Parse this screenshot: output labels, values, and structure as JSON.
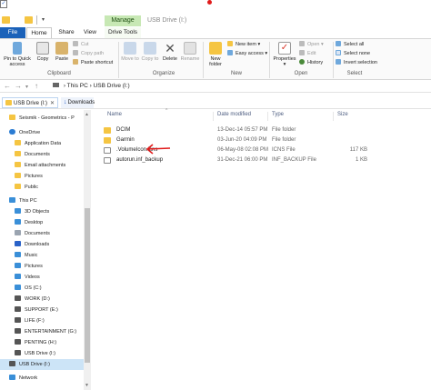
{
  "window": {
    "title": "USB Drive (I:)",
    "contextual_tab": "Manage"
  },
  "tabs": {
    "file": "File",
    "home": "Home",
    "share": "Share",
    "view": "View",
    "drive_tools": "Drive Tools"
  },
  "ribbon": {
    "clipboard": {
      "label": "Clipboard",
      "pin": "Pin to Quick access",
      "copy": "Copy",
      "paste": "Paste",
      "cut": "Cut",
      "copy_path": "Copy path",
      "paste_shortcut": "Paste shortcut"
    },
    "organize": {
      "label": "Organize",
      "move_to": "Move to",
      "copy_to": "Copy to",
      "delete": "Delete",
      "rename": "Rename"
    },
    "new": {
      "label": "New",
      "new_folder": "New folder",
      "new_item": "New item",
      "easy_access": "Easy access"
    },
    "open": {
      "label": "Open",
      "properties": "Properties",
      "open": "Open",
      "edit": "Edit",
      "history": "History"
    },
    "select": {
      "label": "Select",
      "select_all": "Select all",
      "select_none": "Select none",
      "invert": "Invert selection"
    }
  },
  "address": {
    "crumb1": "This PC",
    "crumb2": "USB Drive (I:)"
  },
  "nav_tabs": {
    "active": "USB Drive (I:)",
    "inactive": "Downloads"
  },
  "nav_items": [
    {
      "label": "Seismik - Geometrics - P",
      "icon": "folder",
      "color": "#f5c542"
    },
    {
      "label": "OneDrive",
      "icon": "cloud",
      "color": "#2b7cd3"
    },
    {
      "label": "Application Data",
      "icon": "folder",
      "color": "#f5c542"
    },
    {
      "label": "Documents",
      "icon": "folder",
      "color": "#f5c542"
    },
    {
      "label": "Email attachments",
      "icon": "folder",
      "color": "#f5c542"
    },
    {
      "label": "Pictures",
      "icon": "folder",
      "color": "#f5c542"
    },
    {
      "label": "Public",
      "icon": "folder",
      "color": "#f5c542"
    },
    {
      "label": "This PC",
      "icon": "computer",
      "color": "#3a8fd8"
    },
    {
      "label": "3D Objects",
      "icon": "cube",
      "color": "#3a8fd8"
    },
    {
      "label": "Desktop",
      "icon": "desktop",
      "color": "#3a8fd8"
    },
    {
      "label": "Documents",
      "icon": "document",
      "color": "#9aa4b0"
    },
    {
      "label": "Downloads",
      "icon": "download",
      "color": "#2a62c8"
    },
    {
      "label": "Music",
      "icon": "music",
      "color": "#3a8fd8"
    },
    {
      "label": "Pictures",
      "icon": "picture",
      "color": "#3a8fd8"
    },
    {
      "label": "Videos",
      "icon": "video",
      "color": "#3a8fd8"
    },
    {
      "label": "OS (C:)",
      "icon": "drive-os",
      "color": "#3a8fd8"
    },
    {
      "label": "WORK (D:)",
      "icon": "drive",
      "color": "#555555"
    },
    {
      "label": "SUPPORT (E:)",
      "icon": "drive",
      "color": "#555555"
    },
    {
      "label": "LIFE (F:)",
      "icon": "drive",
      "color": "#555555"
    },
    {
      "label": "ENTERTAINMENT (G:)",
      "icon": "drive",
      "color": "#555555"
    },
    {
      "label": "PENTING (H:)",
      "icon": "drive",
      "color": "#555555"
    },
    {
      "label": "USB Drive (I:)",
      "icon": "usb-drive",
      "color": "#555555"
    },
    {
      "label": "USB Drive (I:)",
      "icon": "usb-drive",
      "color": "#555555",
      "selected": true
    },
    {
      "label": "Network",
      "icon": "network",
      "color": "#3a8fd8"
    }
  ],
  "columns": {
    "name": "Name",
    "date": "Date modified",
    "type": "Type",
    "size": "Size"
  },
  "files": [
    {
      "name": "DCIM",
      "date": "13-Dec-14 05:57 PM",
      "type": "File folder",
      "size": "",
      "icon": "folder"
    },
    {
      "name": "Garmin",
      "date": "03-Jun-20 04:09 PM",
      "type": "File folder",
      "size": "",
      "icon": "folder"
    },
    {
      "name": ".VolumeIcon.icns",
      "date": "06-May-08 02:08 PM",
      "type": "ICNS File",
      "size": "117 KB",
      "icon": "file"
    },
    {
      "name": "autorun.inf_backup",
      "date": "31-Dec-21 06:00 PM",
      "type": "INF_BACKUP File",
      "size": "1 KB",
      "icon": "file"
    }
  ]
}
